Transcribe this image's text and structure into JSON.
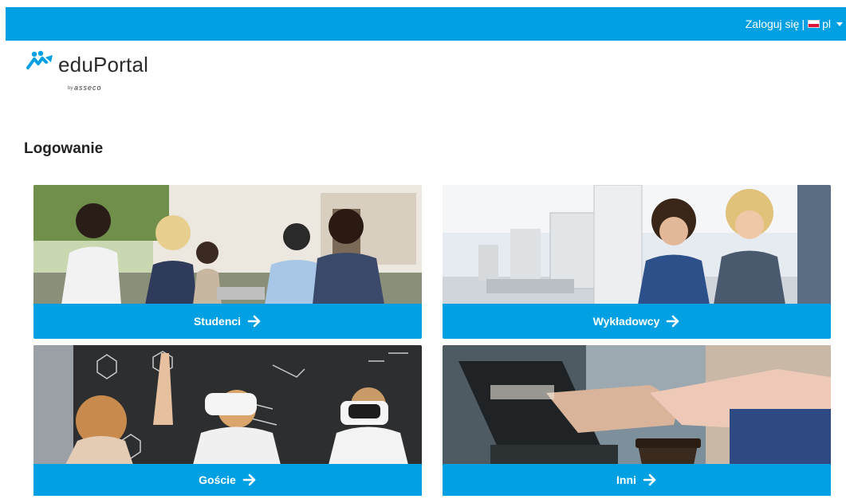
{
  "header": {
    "login_label": "Zaloguj się",
    "separator": "|",
    "language": "pl",
    "accent_color": "#00a0e3"
  },
  "logo": {
    "name": "eduPortal",
    "byline": "by",
    "brand": "asseco"
  },
  "page": {
    "title": "Logowanie"
  },
  "cards": [
    {
      "label": "Studenci",
      "photo": "students-outdoors-photo",
      "icon": "arrow-right-icon"
    },
    {
      "label": "Wykładowcy",
      "photo": "computer-lab-photo",
      "icon": "arrow-right-icon"
    },
    {
      "label": "Goście",
      "photo": "vr-headset-classroom-photo",
      "icon": "arrow-right-icon"
    },
    {
      "label": "Inni",
      "photo": "laptop-coffee-photo",
      "icon": "arrow-right-icon"
    }
  ]
}
